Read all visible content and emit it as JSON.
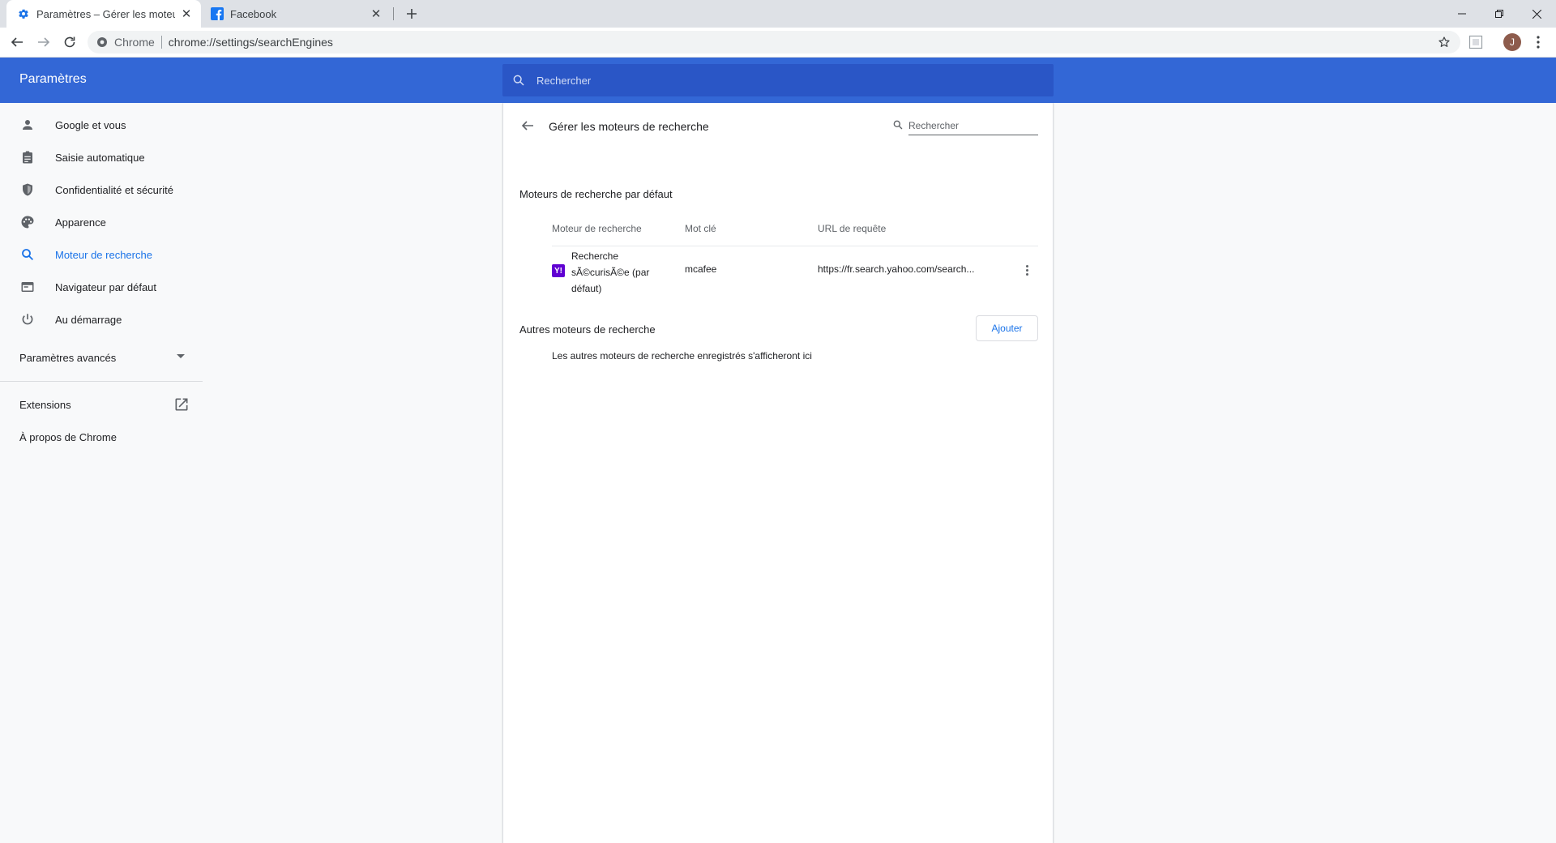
{
  "browser": {
    "tabs": [
      {
        "title": "Paramètres – Gérer les moteurs de recherche",
        "active": true,
        "icon": "gear-icon"
      },
      {
        "title": "Facebook",
        "active": false,
        "icon": "facebook-icon"
      }
    ],
    "omnibox": {
      "chip": "Chrome",
      "url": "chrome://settings/searchEngines"
    },
    "profile_initial": "J"
  },
  "header": {
    "title": "Paramètres",
    "search_placeholder": "Rechercher"
  },
  "sidebar": {
    "items": [
      {
        "label": "Google et vous",
        "icon": "person-icon"
      },
      {
        "label": "Saisie automatique",
        "icon": "clipboard-icon"
      },
      {
        "label": "Confidentialité et sécurité",
        "icon": "shield-icon"
      },
      {
        "label": "Apparence",
        "icon": "palette-icon"
      },
      {
        "label": "Moteur de recherche",
        "icon": "search-icon",
        "selected": true
      },
      {
        "label": "Navigateur par défaut",
        "icon": "browser-icon"
      },
      {
        "label": "Au démarrage",
        "icon": "power-icon"
      }
    ],
    "advanced": "Paramètres avancés",
    "extensions": "Extensions",
    "about": "À propos de Chrome"
  },
  "page": {
    "title": "Gérer les moteurs de recherche",
    "search_placeholder": "Rechercher",
    "default_section": "Moteurs de recherche par défaut",
    "columns": [
      "Moteur de recherche",
      "Mot clé",
      "URL de requête"
    ],
    "default_engines": [
      {
        "name": "Recherche sÃ©curisÃ©e (par défaut)",
        "keyword": "mcafee",
        "url": "https://fr.search.yahoo.com/search...",
        "favicon_letter": "Y!"
      }
    ],
    "other_section": "Autres moteurs de recherche",
    "add_button": "Ajouter",
    "empty_message": "Les autres moteurs de recherche enregistrés s'afficheront ici"
  },
  "colors": {
    "accent": "#3367d6",
    "link": "#1a73e8",
    "yahoo": "#6001d2"
  }
}
